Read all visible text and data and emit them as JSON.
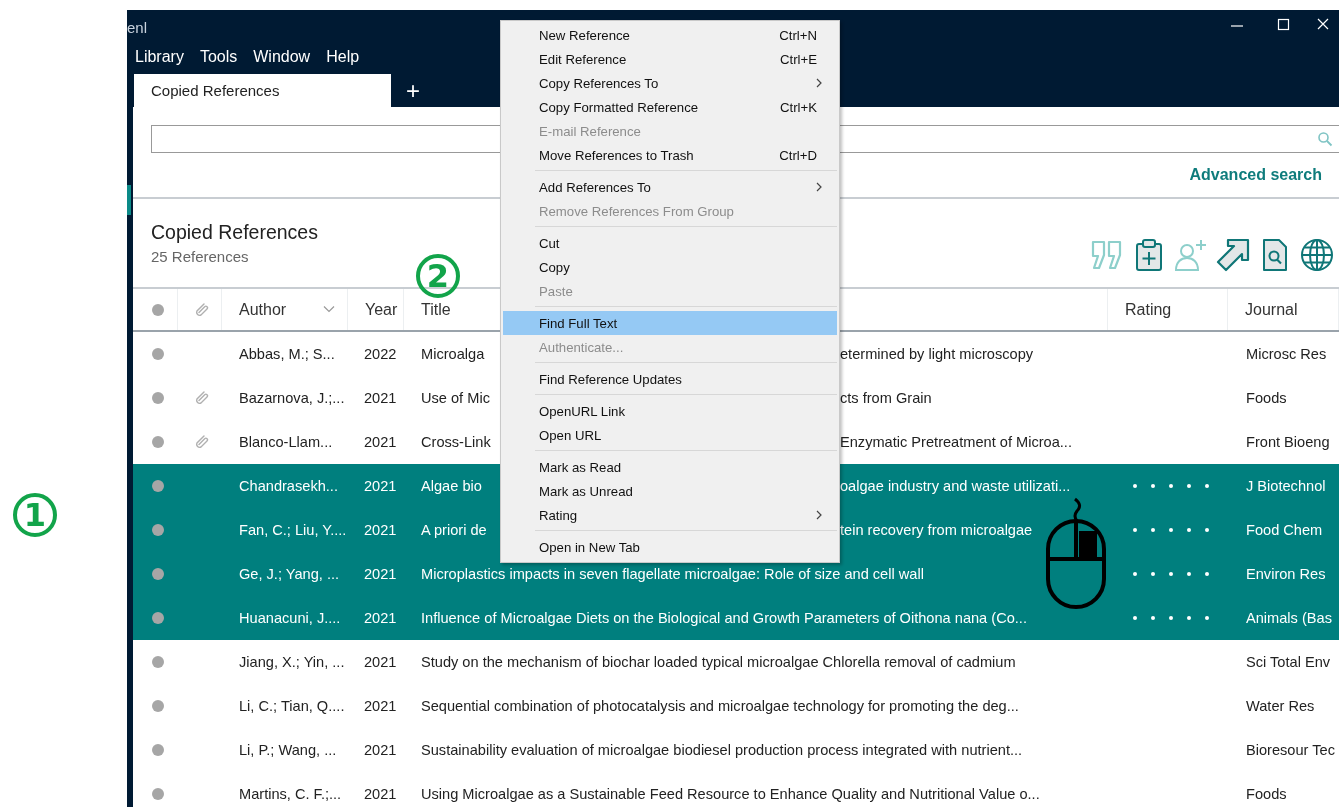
{
  "window": {
    "title": "enl"
  },
  "menu_bar": [
    "Library",
    "Tools",
    "Window",
    "Help"
  ],
  "tabs": [
    {
      "label": "Copied References",
      "selected": true
    }
  ],
  "new_tab_button": "+",
  "advanced_search": "Advanced search",
  "group": {
    "title": "Copied References",
    "count": "25 References"
  },
  "toolbar": [
    {
      "kind": "quote",
      "disabled": true
    },
    {
      "kind": "clipboard",
      "disabled": false
    },
    {
      "kind": "person",
      "disabled": true
    },
    {
      "kind": "arrow",
      "disabled": false
    },
    {
      "kind": "document",
      "disabled": false
    },
    {
      "kind": "globe",
      "disabled": false
    }
  ],
  "table": {
    "columns": [
      {
        "kind": "read"
      },
      {
        "kind": "attachment"
      },
      {
        "kind": "text",
        "label": "Author",
        "chevron": true
      },
      {
        "kind": "text",
        "label": "Year",
        "chevron": false
      },
      {
        "kind": "text",
        "label": "Title",
        "chevron": false
      },
      {
        "kind": "text",
        "label": "Rating",
        "chevron": false
      },
      {
        "kind": "text",
        "label": "Journal",
        "chevron": false
      }
    ],
    "rows": [
      {
        "author": "Abbas, M.; S...",
        "year": "2022",
        "title_parts": [
          "Microalga",
          "etermined by light microscopy"
        ],
        "journal": "Microsc Res",
        "attachment": false,
        "selected": false
      },
      {
        "author": "Bazarnova, J.;...",
        "year": "2021",
        "title_parts": [
          "Use of Mic",
          "cts from Grain"
        ],
        "journal": "Foods",
        "attachment": true,
        "selected": false
      },
      {
        "author": "Blanco-Llam...",
        "year": "2021",
        "title_parts": [
          "Cross-Link",
          "Enzymatic Pretreatment of Microa..."
        ],
        "journal": "Front Bioeng",
        "attachment": true,
        "selected": false
      },
      {
        "author": "Chandrasekh...",
        "year": "2021",
        "title_parts": [
          "Algae bio",
          "oalgae industry and waste utilizati..."
        ],
        "journal": "J Biotechnol",
        "attachment": false,
        "selected": true
      },
      {
        "author": "Fan, C.; Liu, Y....",
        "year": "2021",
        "title_parts": [
          "A priori de",
          "tein recovery from microalgae"
        ],
        "journal": "Food Chem",
        "attachment": false,
        "selected": true
      },
      {
        "author": "Ge, J.; Yang, ...",
        "year": "2021",
        "title": "Microplastics impacts in seven flagellate microalgae: Role of size and cell wall",
        "journal": "Environ Res",
        "attachment": false,
        "selected": true
      },
      {
        "author": "Huanacuni, J....",
        "year": "2021",
        "title": "Influence of Microalgae Diets on the Biological and Growth Parameters of Oithona nana (Co...",
        "journal": "Animals (Bas",
        "attachment": false,
        "selected": true
      },
      {
        "author": "Jiang, X.; Yin, ...",
        "year": "2021",
        "title": "Study on the mechanism of biochar loaded typical microalgae Chlorella removal of cadmium",
        "journal": "Sci Total Env",
        "attachment": false,
        "selected": false
      },
      {
        "author": "Li, C.; Tian, Q....",
        "year": "2021",
        "title": "Sequential combination of photocatalysis and microalgae technology for promoting the deg...",
        "journal": "Water Res",
        "attachment": false,
        "selected": false
      },
      {
        "author": "Li, P.; Wang, ...",
        "year": "2021",
        "title": "Sustainability evaluation of microalgae biodiesel production process integrated with nutrient...",
        "journal": "Bioresour Tec",
        "attachment": false,
        "selected": false
      },
      {
        "author": "Martins, C. F.;...",
        "year": "2021",
        "title": "Using Microalgae as a Sustainable Feed Resource to Enhance Quality and Nutritional Value o...",
        "journal": "Foods",
        "attachment": false,
        "selected": false
      }
    ]
  },
  "context_menu": {
    "groups": [
      [
        {
          "label": "New Reference",
          "shortcut": "Ctrl+N",
          "submenu": false,
          "disabled": false,
          "selected": false
        },
        {
          "label": "Edit Reference",
          "shortcut": "Ctrl+E",
          "submenu": false,
          "disabled": false,
          "selected": false
        },
        {
          "label": "Copy References To",
          "submenu": true,
          "disabled": false,
          "selected": false
        },
        {
          "label": "Copy Formatted Reference",
          "shortcut": "Ctrl+K",
          "submenu": false,
          "disabled": false,
          "selected": false
        },
        {
          "label": "E-mail Reference",
          "submenu": false,
          "disabled": true,
          "selected": false
        },
        {
          "label": "Move References to Trash",
          "shortcut": "Ctrl+D",
          "submenu": false,
          "disabled": false,
          "selected": false
        }
      ],
      [
        {
          "label": "Add References To",
          "submenu": true,
          "disabled": false,
          "selected": false
        },
        {
          "label": "Remove References From Group",
          "submenu": false,
          "disabled": true,
          "selected": false
        }
      ],
      [
        {
          "label": "Cut",
          "submenu": false,
          "disabled": false,
          "selected": false
        },
        {
          "label": "Copy",
          "submenu": false,
          "disabled": false,
          "selected": false
        },
        {
          "label": "Paste",
          "submenu": false,
          "disabled": true,
          "selected": false
        }
      ],
      [
        {
          "label": "Find Full Text",
          "submenu": false,
          "disabled": false,
          "selected": true
        },
        {
          "label": "Authenticate...",
          "submenu": false,
          "disabled": true,
          "selected": false
        }
      ],
      [
        {
          "label": "Find Reference Updates",
          "submenu": false,
          "disabled": false,
          "selected": false
        }
      ],
      [
        {
          "label": "OpenURL Link",
          "submenu": false,
          "disabled": false,
          "selected": false
        },
        {
          "label": "Open URL",
          "submenu": false,
          "disabled": false,
          "selected": false
        }
      ],
      [
        {
          "label": "Mark as Read",
          "submenu": false,
          "disabled": false,
          "selected": false
        },
        {
          "label": "Mark as Unread",
          "submenu": false,
          "disabled": false,
          "selected": false
        },
        {
          "label": "Rating",
          "submenu": true,
          "disabled": false,
          "selected": false
        }
      ],
      [
        {
          "label": "Open in New Tab",
          "submenu": false,
          "disabled": false,
          "selected": false
        }
      ]
    ]
  },
  "annotations": [
    {
      "label": "1",
      "color": "#12a44a"
    },
    {
      "label": "2",
      "color": "#12a44a"
    }
  ]
}
